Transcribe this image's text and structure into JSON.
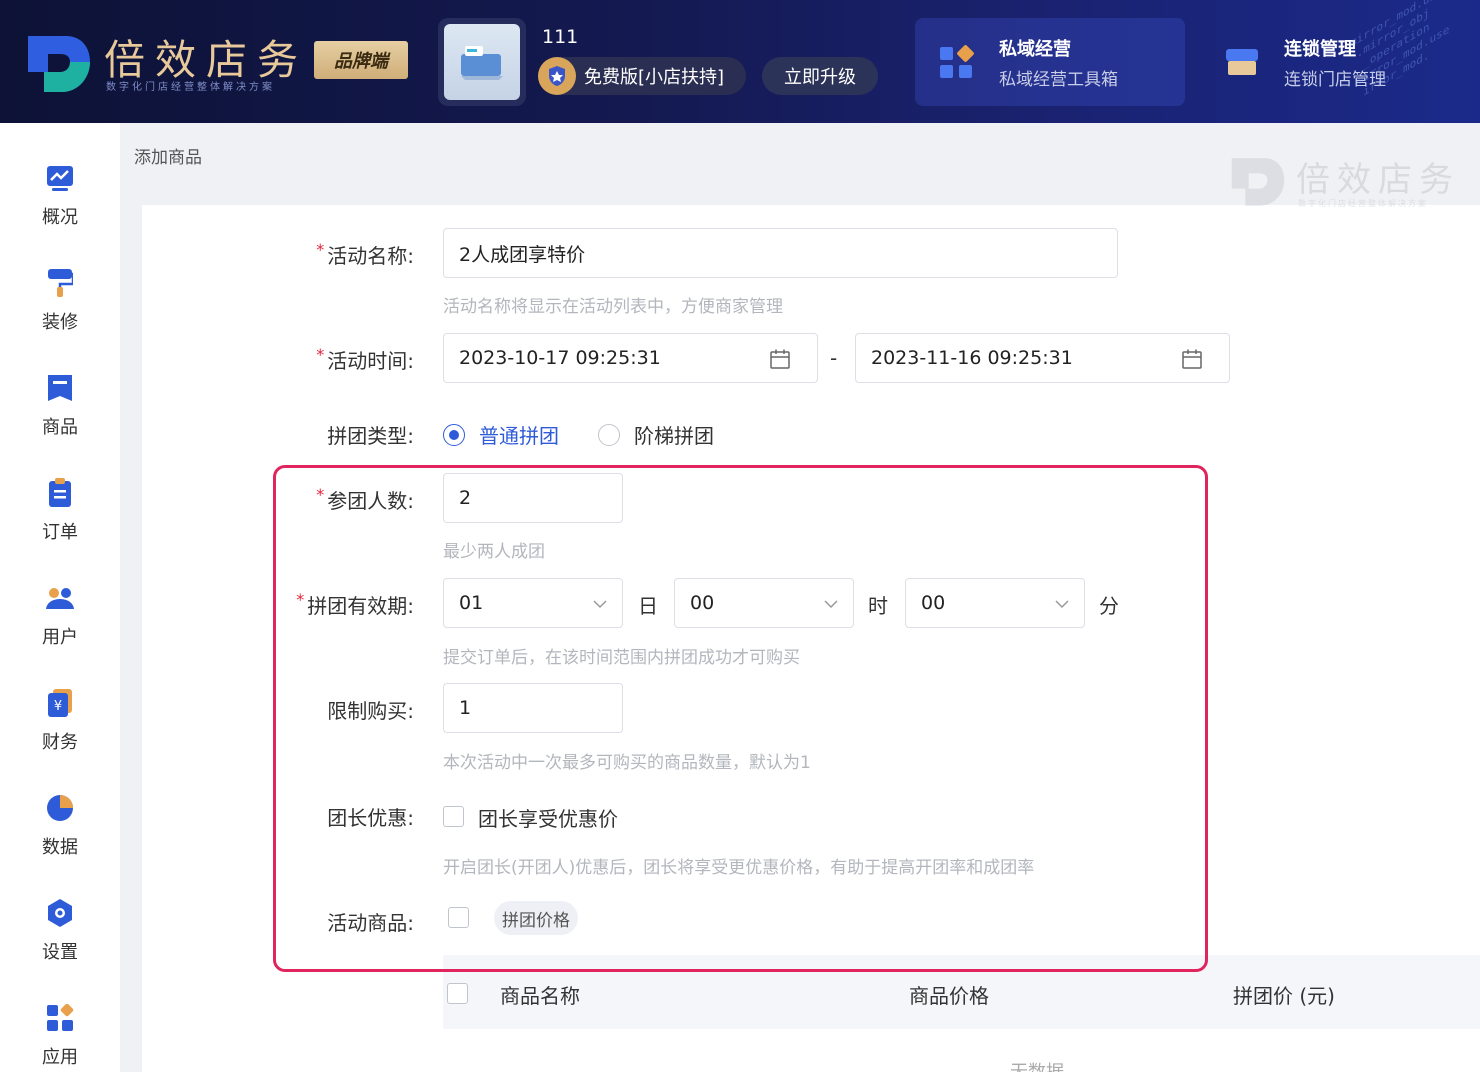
{
  "header": {
    "logo_text": "倍效店务",
    "logo_subtitle": "数字化门店经营整体解决方案",
    "brand_badge": "品牌端",
    "store_name": "111",
    "plan": "免费版[小店扶持]",
    "upgrade_label": "立即升级",
    "tools": [
      {
        "title": "私域经营",
        "subtitle": "私域经营工具箱",
        "icon": "apps-icon"
      },
      {
        "title": "连锁管理",
        "subtitle": "连锁门店管理",
        "icon": "store-icon"
      }
    ]
  },
  "sidebar": {
    "items": [
      {
        "label": "概况",
        "icon": "chart-icon"
      },
      {
        "label": "装修",
        "icon": "paint-roller-icon"
      },
      {
        "label": "商品",
        "icon": "product-icon"
      },
      {
        "label": "订单",
        "icon": "order-icon"
      },
      {
        "label": "用户",
        "icon": "users-icon"
      },
      {
        "label": "财务",
        "icon": "finance-icon"
      },
      {
        "label": "数据",
        "icon": "pie-icon"
      },
      {
        "label": "设置",
        "icon": "settings-icon"
      },
      {
        "label": "应用",
        "icon": "apps-icon"
      }
    ]
  },
  "breadcrumb": "添加商品",
  "watermark": {
    "text": "倍效店务",
    "subtitle": "数字化门店经营整体解决方案"
  },
  "form": {
    "activity_name": {
      "label": "活动名称:",
      "value": "2人成团享特价",
      "hint": "活动名称将显示在活动列表中，方便商家管理"
    },
    "activity_time": {
      "label": "活动时间:",
      "start": "2023-10-17 09:25:31",
      "separator": "-",
      "end": "2023-11-16 09:25:31"
    },
    "group_type": {
      "label": "拼团类型:",
      "options": [
        "普通拼团",
        "阶梯拼团"
      ],
      "selected": "普通拼团"
    },
    "group_size": {
      "label": "参团人数:",
      "value": "2",
      "hint": "最少两人成团"
    },
    "validity": {
      "label": "拼团有效期:",
      "day": "01",
      "day_unit": "日",
      "hour": "00",
      "hour_unit": "时",
      "minute": "00",
      "minute_unit": "分",
      "hint": "提交订单后，在该时间范围内拼团成功才可购买"
    },
    "purchase_limit": {
      "label": "限制购买:",
      "value": "1",
      "hint": "本次活动中一次最多可购买的商品数量，默认为1"
    },
    "leader_discount": {
      "label": "团长优惠:",
      "checkbox_label": "团长享受优惠价",
      "checked": false,
      "hint": "开启团长(开团人)优惠后，团长将享受更优惠价格，有助于提高开团率和成团率"
    },
    "activity_goods": {
      "label": "活动商品:",
      "tag": "拼团价格"
    }
  },
  "table": {
    "columns": [
      "商品名称",
      "商品价格",
      "拼团价 (元)"
    ],
    "empty_text": "无数据"
  },
  "colors": {
    "primary": "#2e5bd8",
    "highlight_border": "#e0245e",
    "required": "#e3243b"
  }
}
